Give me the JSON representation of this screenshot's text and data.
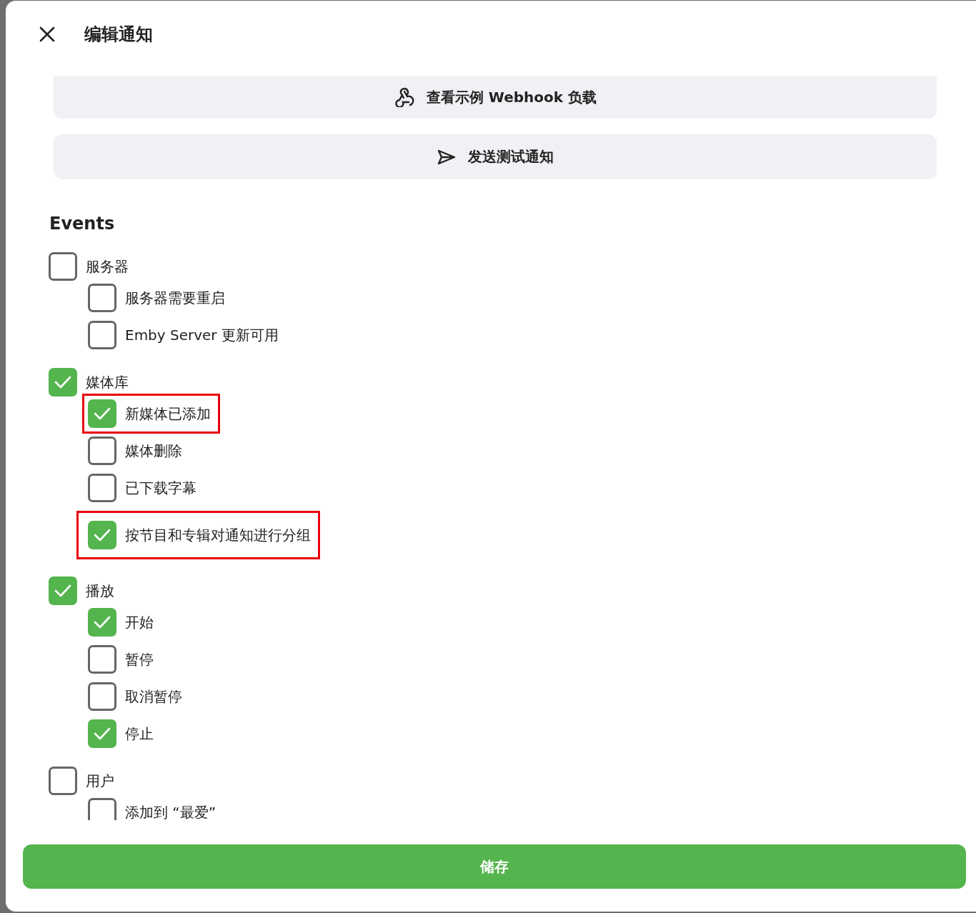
{
  "dialog": {
    "title": "编辑通知"
  },
  "actions": [
    {
      "kind": "webhook",
      "label": "查看示例 Webhook 负载"
    },
    {
      "kind": "send",
      "label": "发送测试通知"
    }
  ],
  "events": {
    "heading": "Events",
    "groups": [
      {
        "label": "服务器",
        "checked": false,
        "children": [
          {
            "label": "服务器需要重启",
            "checked": false,
            "kind": "event",
            "highlighted": false
          },
          {
            "label": "Emby Server 更新可用",
            "checked": false,
            "kind": "event",
            "highlighted": false
          }
        ]
      },
      {
        "label": "媒体库",
        "checked": true,
        "children": [
          {
            "label": "新媒体已添加",
            "checked": true,
            "kind": "event",
            "highlighted": true
          },
          {
            "label": "媒体删除",
            "checked": false,
            "kind": "event",
            "highlighted": false
          },
          {
            "label": "已下载字幕",
            "checked": false,
            "kind": "event",
            "highlighted": false
          },
          {
            "label": "按节目和专辑对通知进行分组",
            "checked": true,
            "kind": "option",
            "highlighted": true
          }
        ]
      },
      {
        "label": "播放",
        "checked": true,
        "children": [
          {
            "label": "开始",
            "checked": true,
            "kind": "event",
            "highlighted": false
          },
          {
            "label": "暂停",
            "checked": false,
            "kind": "event",
            "highlighted": false
          },
          {
            "label": "取消暂停",
            "checked": false,
            "kind": "event",
            "highlighted": false
          },
          {
            "label": "停止",
            "checked": true,
            "kind": "event",
            "highlighted": false
          }
        ]
      },
      {
        "label": "用户",
        "checked": false,
        "children": [
          {
            "label": "添加到 “最爱”",
            "checked": false,
            "kind": "event",
            "highlighted": false
          }
        ]
      }
    ]
  },
  "save_button": "储存"
}
